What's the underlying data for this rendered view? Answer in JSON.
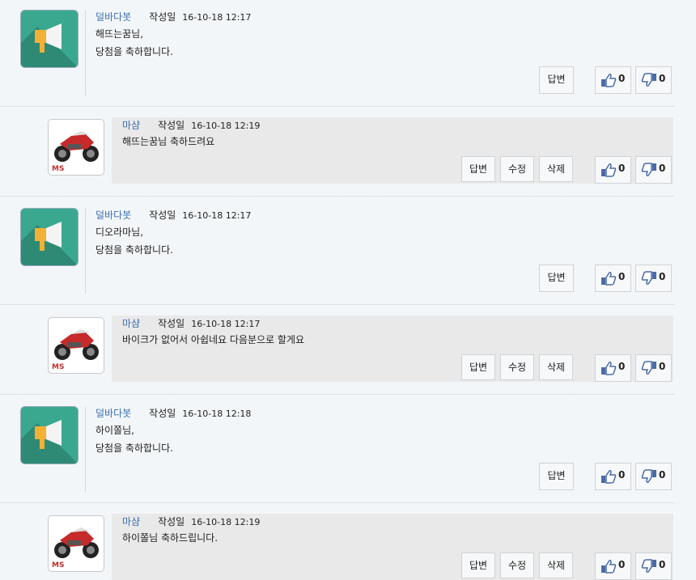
{
  "labels": {
    "written": "작성일",
    "reply": "답변",
    "edit": "수정",
    "delete": "삭제"
  },
  "comments": [
    {
      "author": "덜바다봇",
      "date": "16-10-18 12:17",
      "lines": [
        "해뜨는꿈님,",
        "당첨을 축하합니다."
      ],
      "likes": "0",
      "dislikes": "0"
    },
    {
      "author": "마샴",
      "date": "16-10-18 12:19",
      "lines": [
        "해뜨는꿈님 축하드려요"
      ],
      "likes": "0",
      "dislikes": "0"
    },
    {
      "author": "덜바다봇",
      "date": "16-10-18 12:17",
      "lines": [
        "디오라마님,",
        "당첨을 축하합니다."
      ],
      "likes": "0",
      "dislikes": "0"
    },
    {
      "author": "마샴",
      "date": "16-10-18 12:17",
      "lines": [
        "바이크가 없어서 아쉽네요  다음분으로 할게요"
      ],
      "likes": "0",
      "dislikes": "0"
    },
    {
      "author": "덜바다봇",
      "date": "16-10-18 12:18",
      "lines": [
        "하이쫄님,",
        "당첨을 축하합니다."
      ],
      "likes": "0",
      "dislikes": "0"
    },
    {
      "author": "마샴",
      "date": "16-10-18 12:19",
      "lines": [
        "하이쫄님 축하드립니다."
      ],
      "likes": "0",
      "dislikes": "0"
    }
  ],
  "avatars": {
    "bot_icon": "megaphone-icon",
    "user_icon": "motorcycle-image",
    "user_badge": "MS"
  },
  "icons": {
    "like": "thumbs-up-icon",
    "dislike": "thumbs-down-icon"
  },
  "colors": {
    "author": "#3a6fb0",
    "bot_avatar": "#3aa88f",
    "reply_bg": "#e9e9e9"
  }
}
